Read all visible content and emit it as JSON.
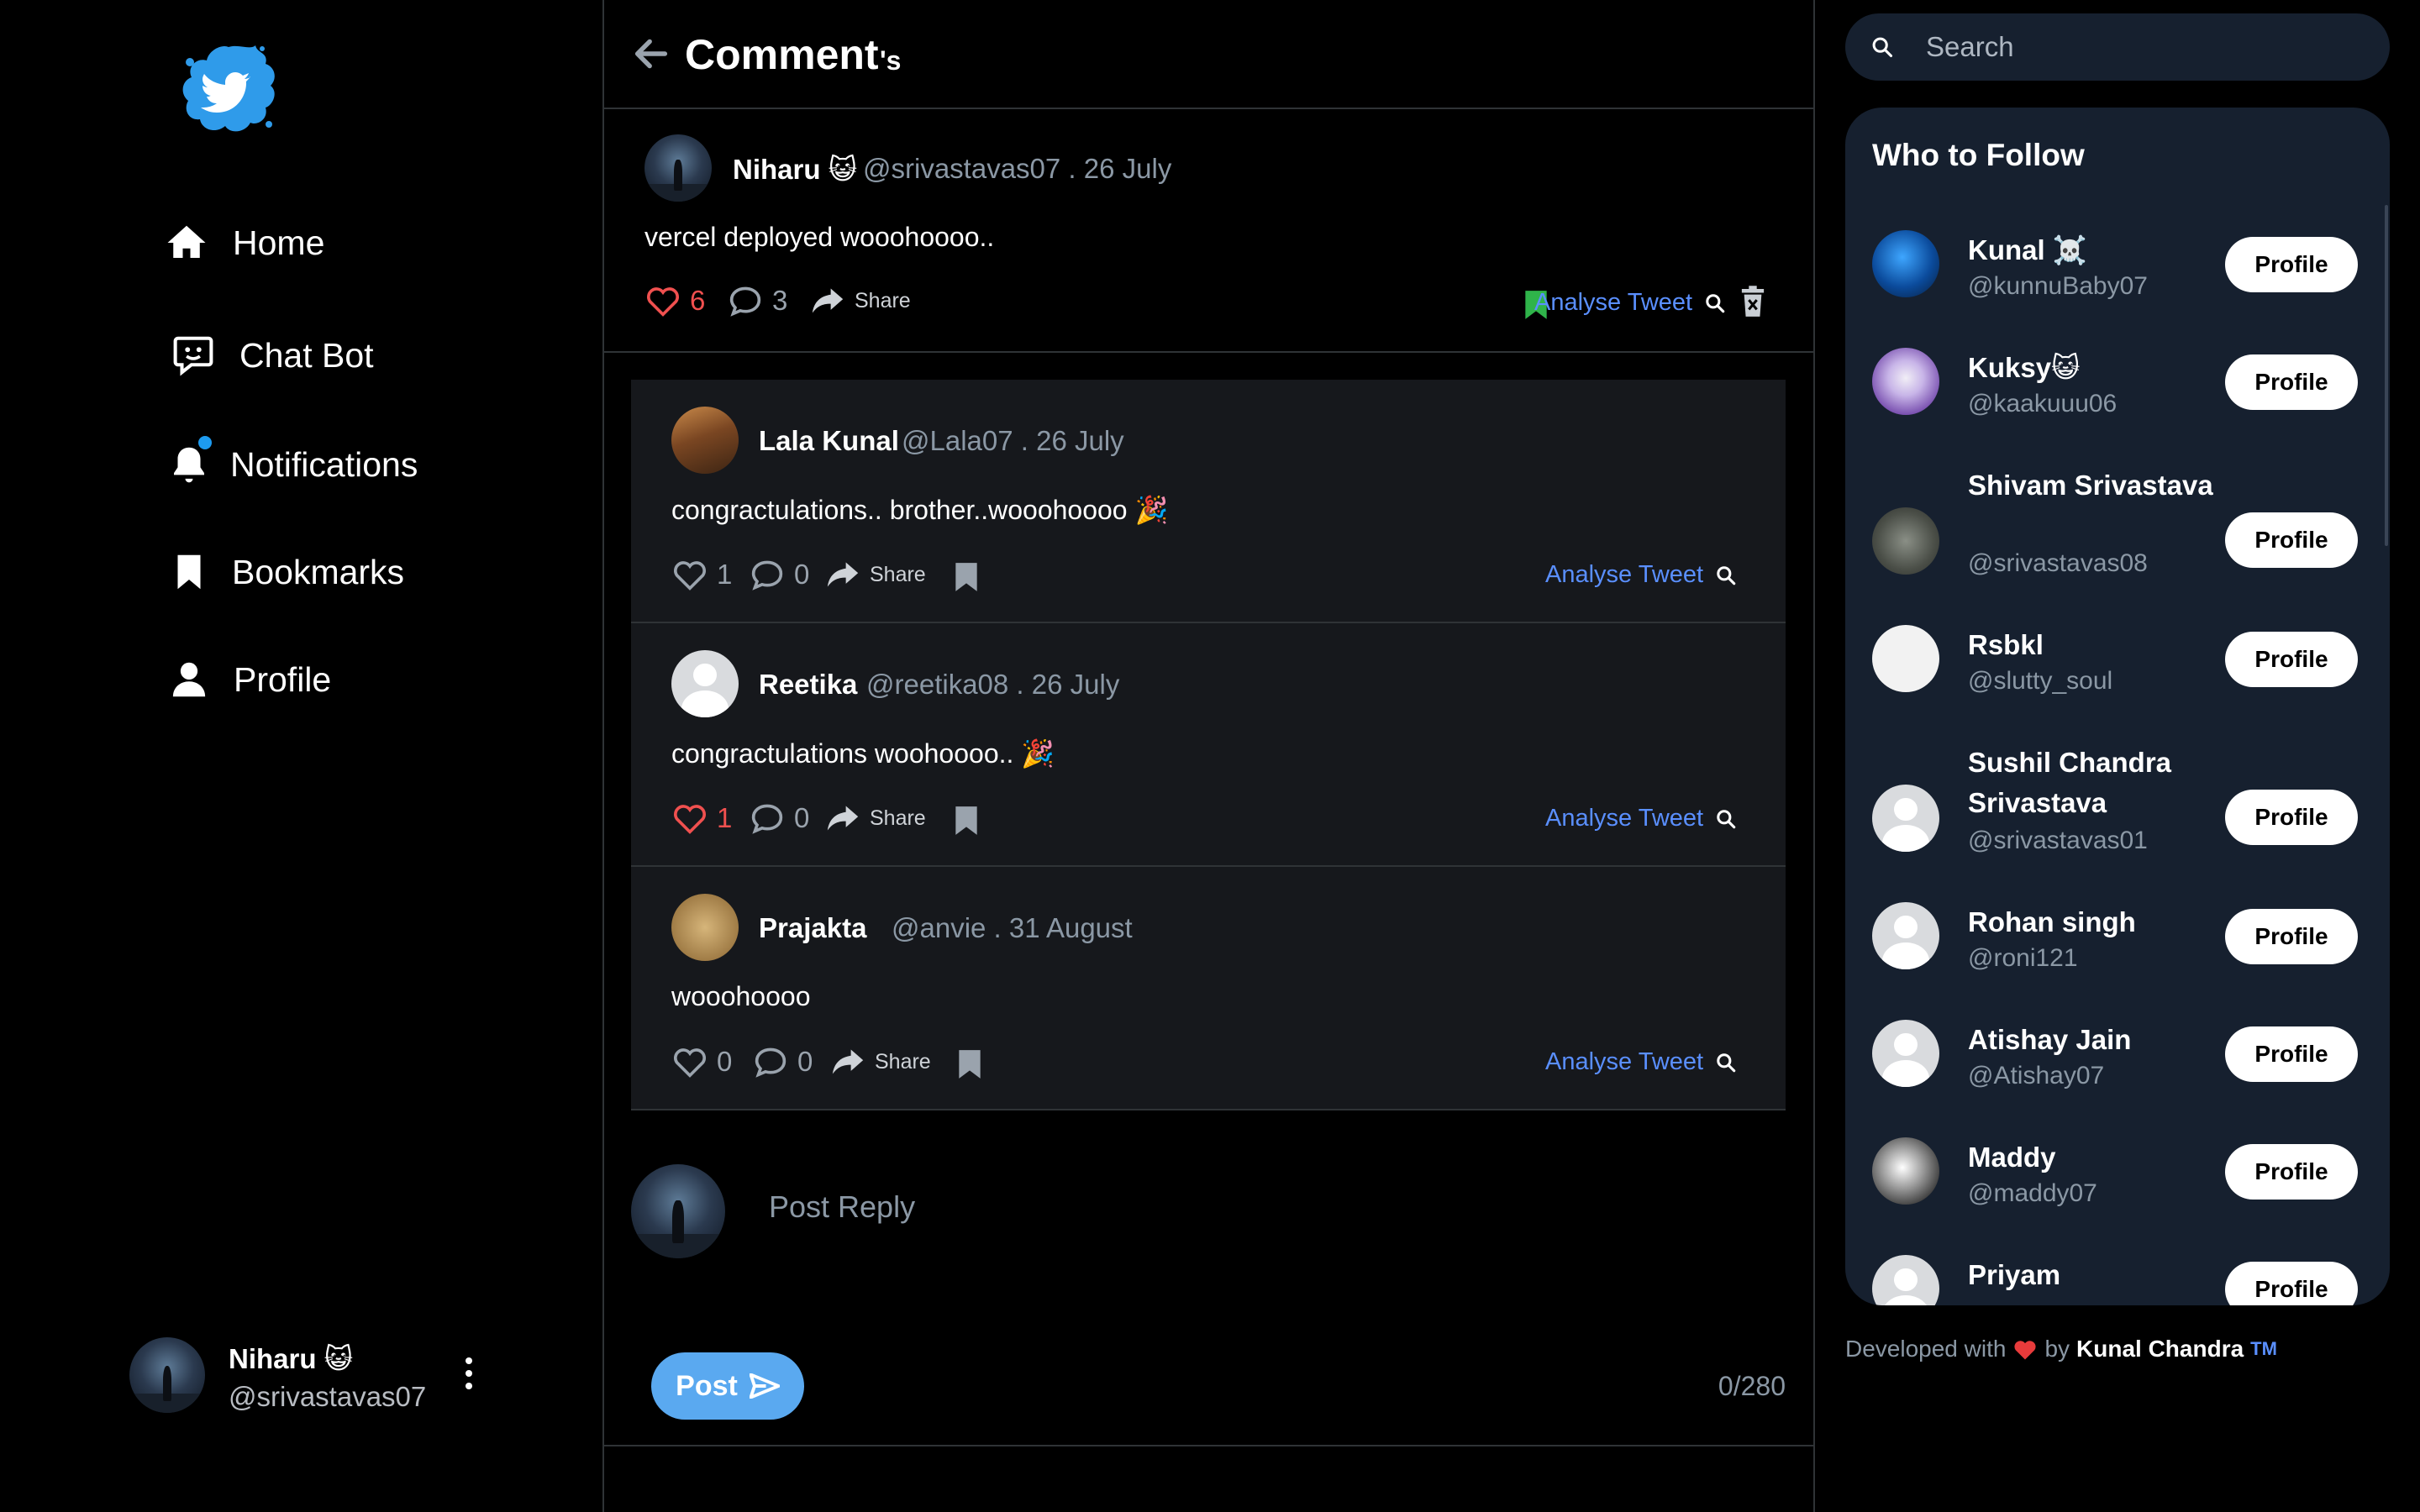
{
  "nav": {
    "items": [
      {
        "label": "Home",
        "icon": "home-icon"
      },
      {
        "label": "Chat Bot",
        "icon": "chat-bot-icon"
      },
      {
        "label": "Notifications",
        "icon": "bell-icon"
      },
      {
        "label": "Bookmarks",
        "icon": "bookmark-icon"
      },
      {
        "label": "Profile",
        "icon": "user-icon"
      }
    ]
  },
  "current_user": {
    "name": "Niharu 😺",
    "handle": "@srivastavas07"
  },
  "header": {
    "title": "Comment",
    "suffix": "'s"
  },
  "main_post": {
    "name": "Niharu 😺",
    "meta": "@srivastavas07 . 26 July",
    "text": "vercel deployed wooohoooo..",
    "likes": "6",
    "comments": "3",
    "share_label": "Share",
    "analyse_label": "Analyse Tweet",
    "liked": true,
    "bookmarked": true
  },
  "replies": [
    {
      "name": "Lala Kunal",
      "meta": "@Lala07 . 26 July",
      "text": "congractulations.. brother..wooohoooo 🎉",
      "likes": "1",
      "comments": "0",
      "share_label": "Share",
      "analyse_label": "Analyse Tweet",
      "liked": false
    },
    {
      "name": "Reetika",
      "meta": "@reetika08 . 26 July",
      "text": "congractulations woohoooo.. 🎉",
      "likes": "1",
      "comments": "0",
      "share_label": "Share",
      "analyse_label": "Analyse Tweet",
      "liked": true
    },
    {
      "name": "Prajakta",
      "meta": "@anvie . 31 August",
      "text": "wooohoooo",
      "likes": "0",
      "comments": "0",
      "share_label": "Share",
      "analyse_label": "Analyse Tweet",
      "liked": false
    }
  ],
  "composer": {
    "placeholder": "Post Reply",
    "post_label": "Post",
    "counter": "0/280"
  },
  "search": {
    "placeholder": "Search"
  },
  "who_to_follow": {
    "title": "Who to Follow",
    "button_label": "Profile",
    "users": [
      {
        "name": "Kunal ☠️",
        "handle": "@kunnuBaby07"
      },
      {
        "name": "Kuksy😺",
        "handle": "@kaakuuu06"
      },
      {
        "name": "Shivam Srivastava",
        "handle": "@srivastavas08"
      },
      {
        "name": "Rsbkl",
        "handle": "@slutty_soul"
      },
      {
        "name": "Sushil Chandra Srivastava",
        "handle": "@srivastavas01"
      },
      {
        "name": "Rohan singh",
        "handle": "@roni121"
      },
      {
        "name": "Atishay Jain",
        "handle": "@Atishay07"
      },
      {
        "name": "Maddy",
        "handle": "@maddy07"
      },
      {
        "name": "Priyam",
        "handle": ""
      }
    ]
  },
  "footer": {
    "prefix": "Developed with",
    "by": "by",
    "author": "Kunal Chandra",
    "tm": "TM"
  },
  "colors": {
    "background": "#000000",
    "panel": "#16202f",
    "like_red": "#f0504f",
    "link_blue": "#5a8fff",
    "post_button": "#5aa9f0",
    "bookmark_green": "#2fb44a"
  }
}
